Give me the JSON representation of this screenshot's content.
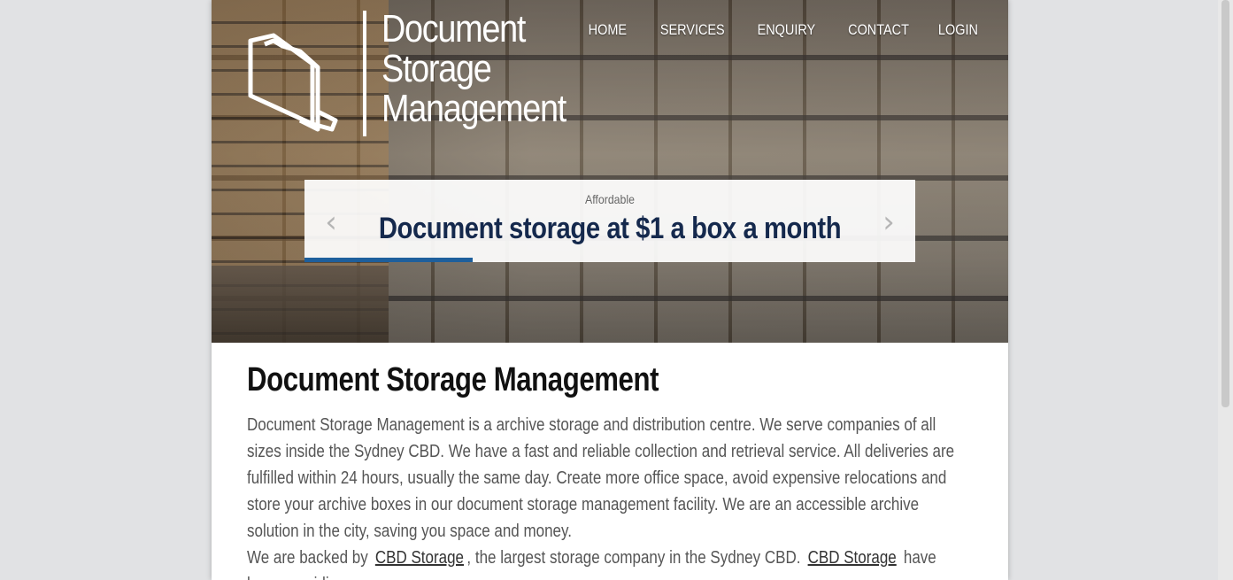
{
  "brand": {
    "logo_lines": [
      "Document",
      "Storage",
      "Management"
    ]
  },
  "nav": {
    "items": [
      "HOME",
      "SERVICES",
      "ENQUIRY",
      "CONTACT",
      "LOGIN"
    ]
  },
  "slider": {
    "kicker": "Affordable",
    "title": "Document storage at $1 a box a month",
    "prev_icon": "chevron-left-icon",
    "next_icon": "chevron-right-icon",
    "progress_fraction": 0.275
  },
  "main": {
    "heading": "Document Storage Management",
    "paragraph1": "Document Storage Management is a archive storage and distribution centre. We serve companies of all sizes inside the Sydney CBD. We have a fast and reliable collection and retrieval service. All deliveries are fulfilled within 24 hours, usually the same day. Create more office space, avoid expensive relocations and store your archive boxes in our document storage management facility. We are an accessible archive solution in the city, saving you space and money.",
    "paragraph2": {
      "part1": "We are backed by",
      "link1": "CBD Storage",
      "part2": ", the largest storage company in the Sydney CBD.",
      "link2": "CBD Storage",
      "part3": "have been providing"
    }
  },
  "colors": {
    "page_background": "#e1e2e4",
    "slide_title": "#15294d",
    "progress_bar": "#1e5f9c"
  }
}
